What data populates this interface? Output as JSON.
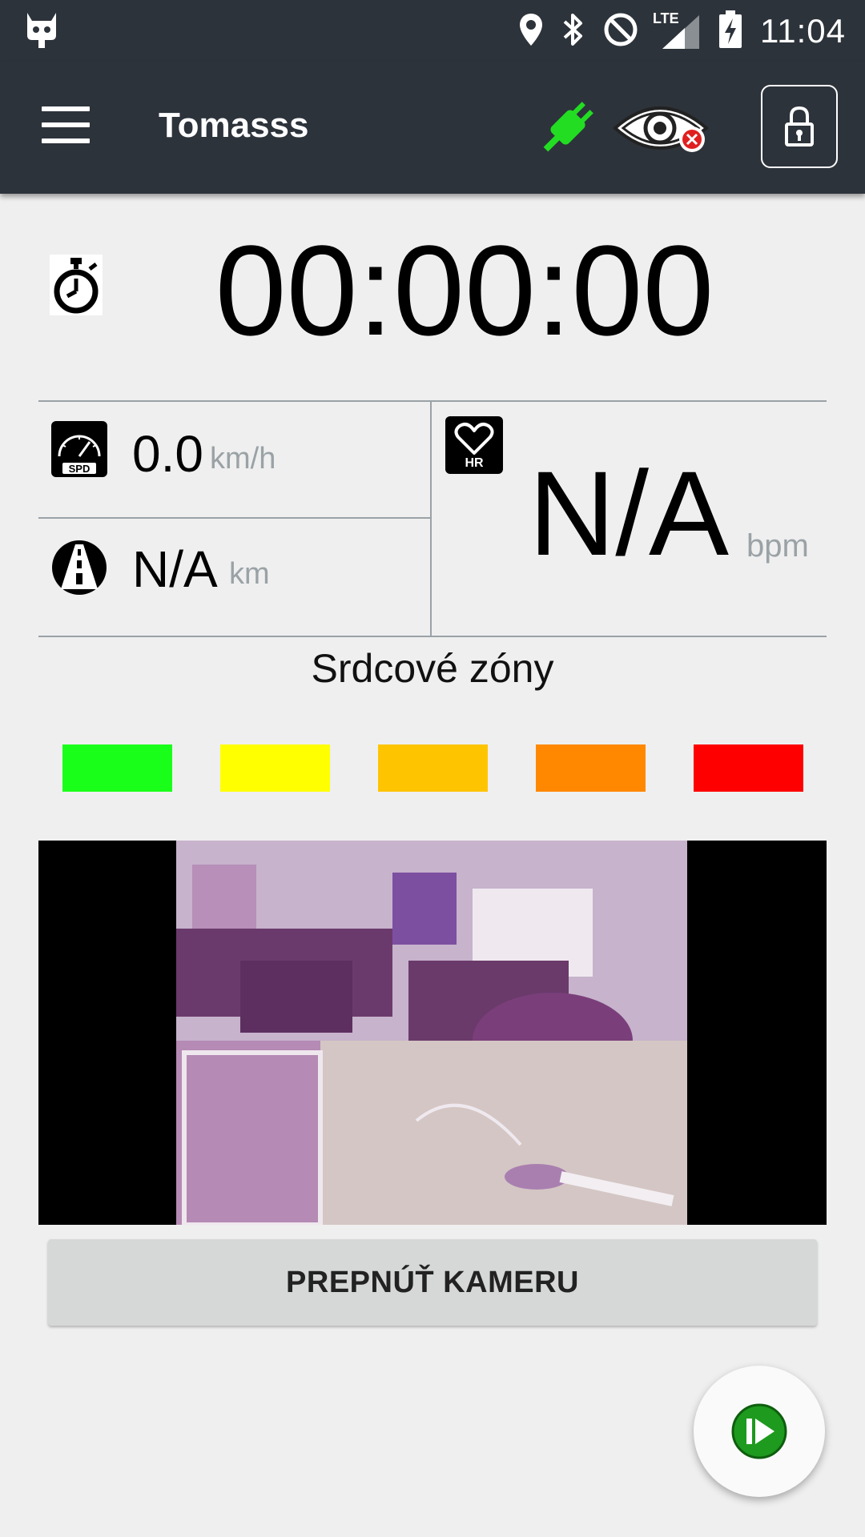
{
  "status_bar": {
    "network": "LTE",
    "time": "11:04",
    "icons": [
      "cyanogen-icon",
      "location-icon",
      "bluetooth-icon",
      "do-not-disturb-icon",
      "signal-icon",
      "battery-charging-icon"
    ]
  },
  "app_bar": {
    "title": "Tomasss",
    "icons": [
      "menu-icon",
      "plug-connected-icon",
      "eye-disabled-icon",
      "lock-icon"
    ]
  },
  "timer": {
    "value": "00:00:00"
  },
  "metrics": {
    "speed": {
      "icon_label": "SPD",
      "value": "0.0",
      "unit": "km/h"
    },
    "distance": {
      "value": "N/A",
      "unit": "km"
    },
    "heart_rate": {
      "icon_label": "HR",
      "value": "N/A",
      "unit": "bpm"
    }
  },
  "zones": {
    "title": "Srdcové zóny",
    "colors": [
      "#1aff1a",
      "#ffff00",
      "#ffc400",
      "#ff8800",
      "#ff0000"
    ]
  },
  "camera_button": {
    "label": "PREPNÚŤ KAMERU"
  },
  "fab": {
    "icon": "play-skip-icon"
  },
  "colors": {
    "bar_bg": "#2d333b",
    "accent_green": "#22dd22",
    "page_bg": "#efefef"
  }
}
